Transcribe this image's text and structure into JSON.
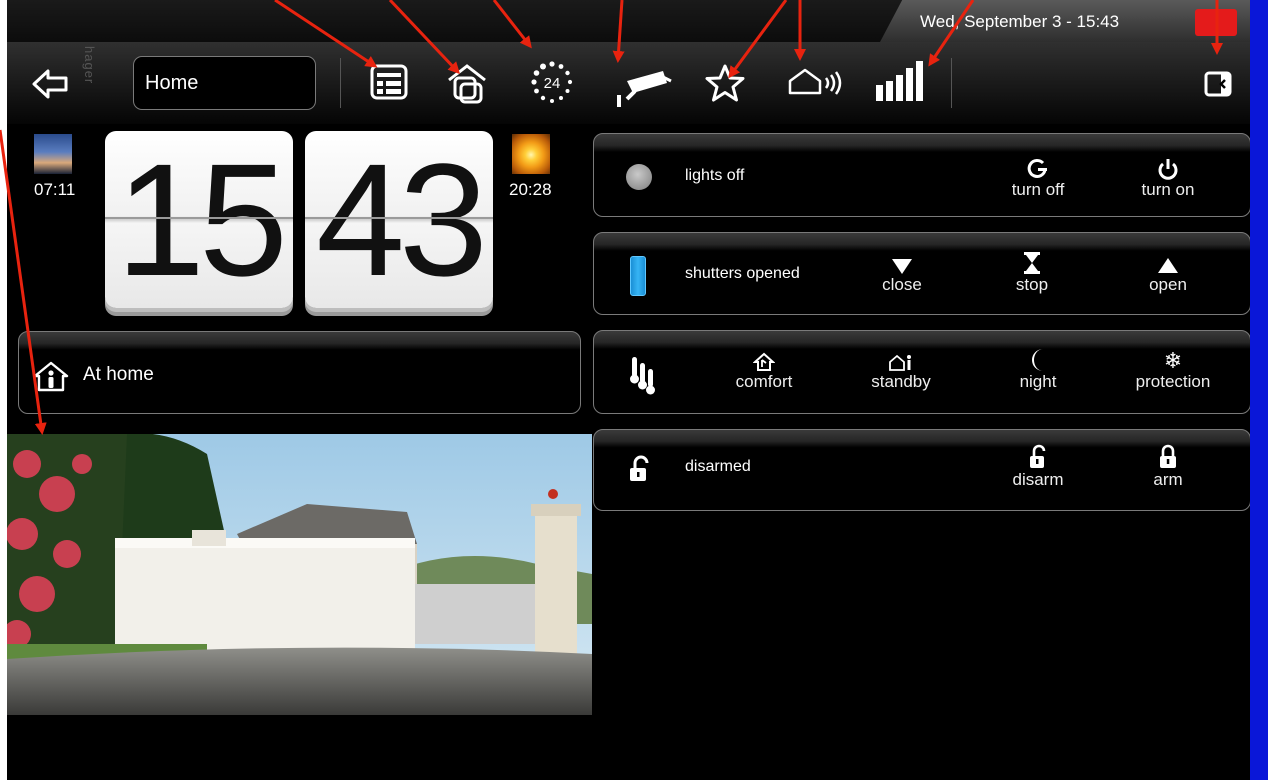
{
  "status": {
    "datetime": "Wed, September 3 - 15:43",
    "accent": "#e41b1b"
  },
  "toolbar": {
    "room_value": "Home",
    "brand": "hager"
  },
  "clock": {
    "hours": "15",
    "minutes": "43",
    "sunrise": "07:11",
    "sunset": "20:28"
  },
  "mode": {
    "label": "At home"
  },
  "lights": {
    "status": "lights off",
    "actions": [
      "turn off",
      "turn on"
    ]
  },
  "shutters": {
    "status": "shutters opened",
    "actions": [
      "close",
      "stop",
      "open"
    ]
  },
  "heating": {
    "actions": [
      "comfort",
      "standby",
      "night",
      "protection"
    ]
  },
  "alarm": {
    "status": "disarmed",
    "actions": [
      "disarm",
      "arm"
    ]
  },
  "colors": {
    "arrow": "#e8230f",
    "sidebar": "#0a17d8"
  }
}
